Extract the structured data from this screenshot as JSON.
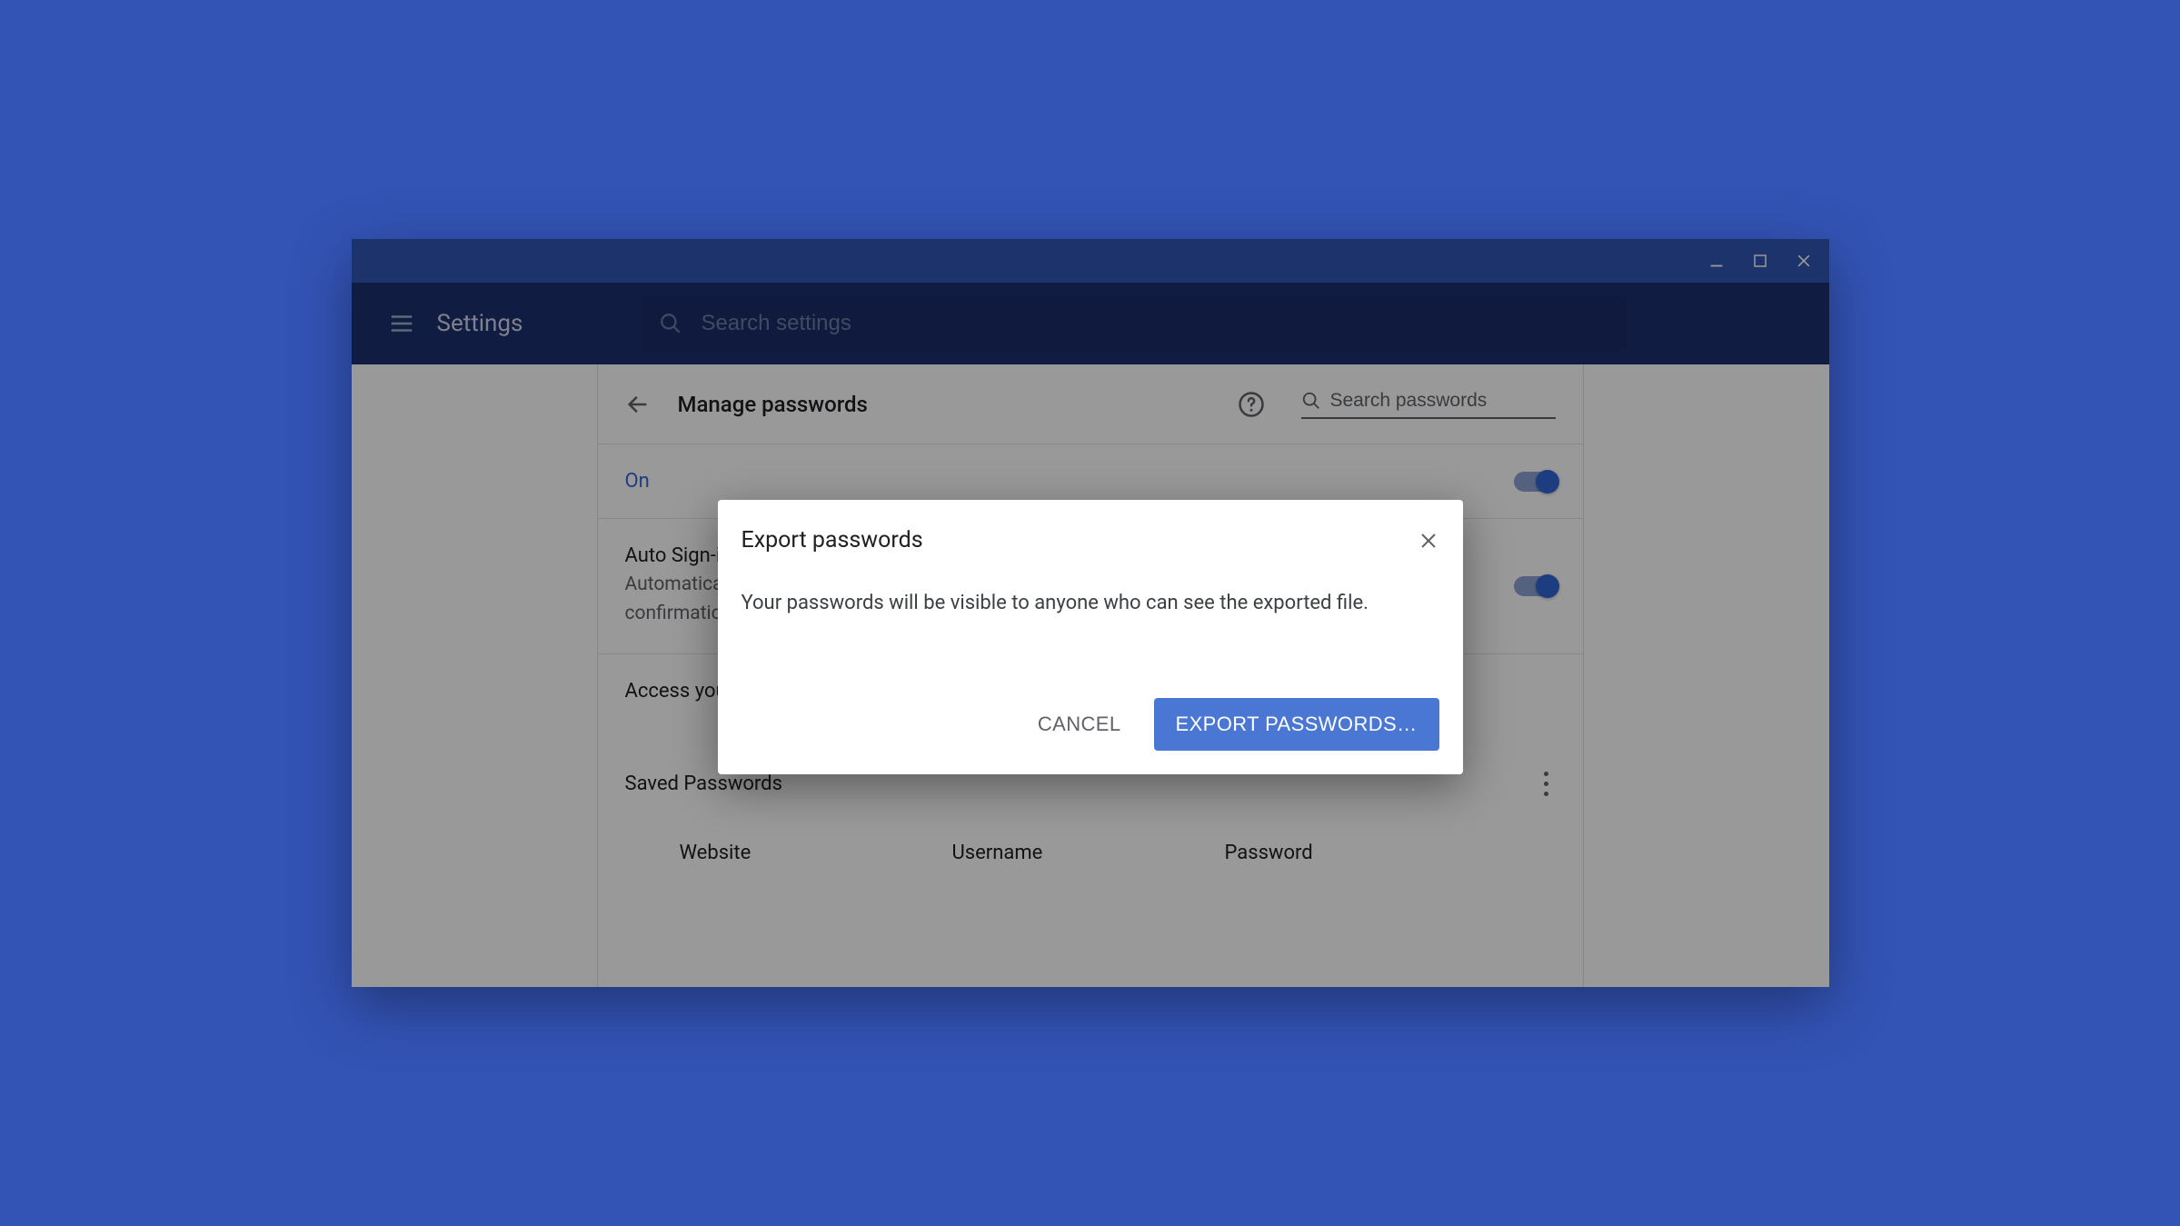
{
  "app": {
    "title": "Settings",
    "search_placeholder": "Search settings"
  },
  "page": {
    "title": "Manage passwords",
    "search_placeholder": "Search passwords",
    "on_label": "On",
    "auto_signin": {
      "title": "Auto Sign-in",
      "desc_line1": "Automatically",
      "desc_line2": "confirmation"
    },
    "access_text": "Access your",
    "saved": {
      "title": "Saved Passwords",
      "col_website": "Website",
      "col_username": "Username",
      "col_password": "Password"
    }
  },
  "dialog": {
    "title": "Export passwords",
    "body": "Your passwords will be visible to anyone who can see the exported file.",
    "cancel": "CANCEL",
    "confirm": "EXPORT PASSWORDS…"
  }
}
